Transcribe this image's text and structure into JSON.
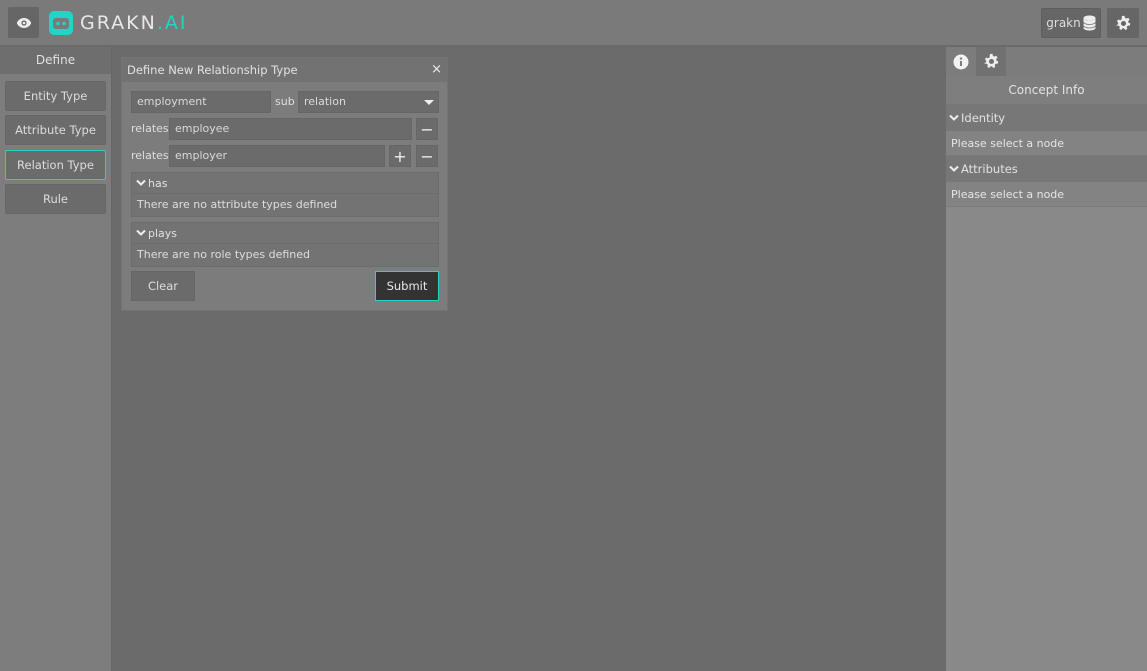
{
  "header": {
    "logo_text": "GRAKN",
    "logo_suffix": ".AI",
    "keyspace_label": "grakn"
  },
  "sidebar": {
    "title": "Define",
    "items": [
      {
        "label": "Entity Type"
      },
      {
        "label": "Attribute Type"
      },
      {
        "label": "Relation Type"
      },
      {
        "label": "Rule"
      }
    ]
  },
  "dialog": {
    "title": "Define New Relationship Type",
    "close_glyph": "×",
    "name_value": "employment",
    "sub_label": "sub",
    "sub_value": "relation",
    "relates_label": "relates",
    "roles": [
      {
        "value": "employee"
      },
      {
        "value": "employer"
      }
    ],
    "has_label": "has",
    "has_empty": "There are no attribute types defined",
    "plays_label": "plays",
    "plays_empty": "There are no role types defined",
    "clear_label": "Clear",
    "submit_label": "Submit",
    "plus_glyph": "+",
    "minus_glyph": "−"
  },
  "right_panel": {
    "concept_info_title": "Concept Info",
    "identity_label": "Identity",
    "identity_empty": "Please select a node",
    "attributes_label": "Attributes",
    "attributes_empty": "Please select a node"
  },
  "colors": {
    "accent": "#1fd5c4",
    "background": "#6b6b6b"
  },
  "icons": [
    "eye-icon",
    "grakn-logo-icon",
    "database-icon",
    "gear-icon",
    "info-icon",
    "close-icon",
    "plus-icon",
    "minus-icon",
    "chevron-down-icon",
    "caret-down-icon"
  ]
}
